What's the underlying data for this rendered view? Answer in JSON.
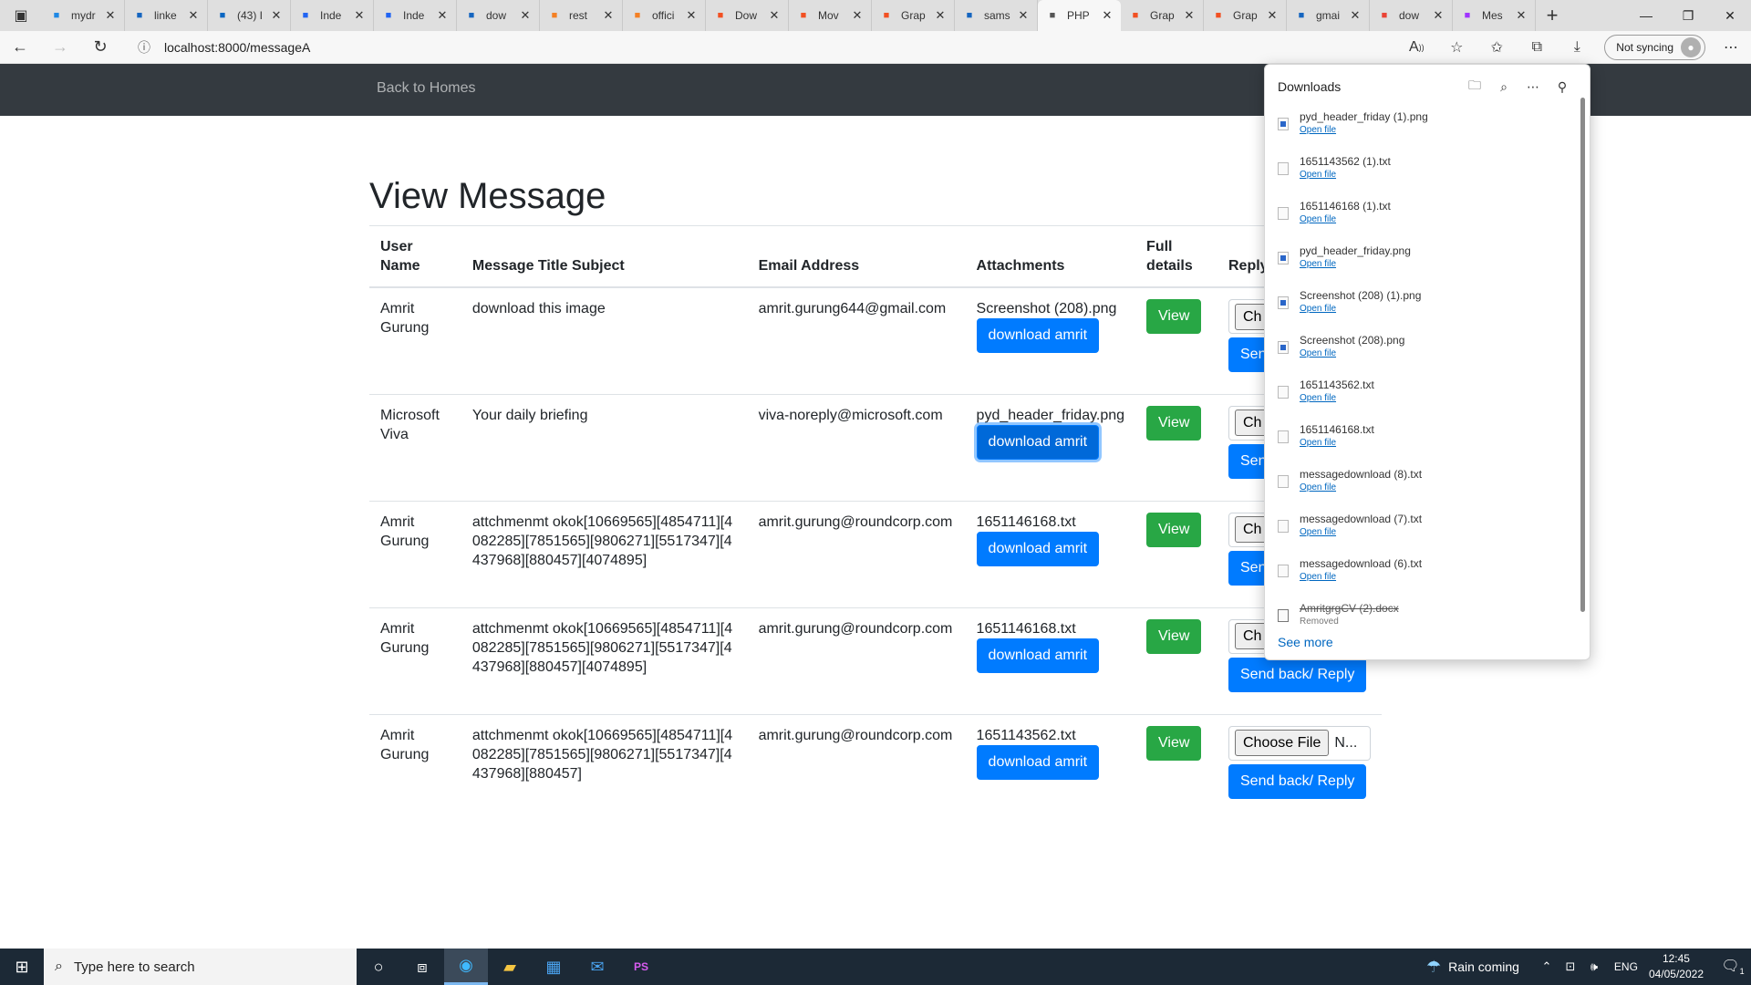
{
  "browser": {
    "tabs": [
      {
        "title": "mydr",
        "favicon": "m-logo-icon",
        "color": "#1e88e5"
      },
      {
        "title": "linke",
        "favicon": "search-icon",
        "color": "#1565c0"
      },
      {
        "title": "(43) I",
        "favicon": "linkedin-icon",
        "color": "#0a66c2"
      },
      {
        "title": "Inde",
        "favicon": "indeed-i-icon",
        "color": "#2164f3"
      },
      {
        "title": "Inde",
        "favicon": "indeed-icon",
        "color": "#2164f3"
      },
      {
        "title": "dow",
        "favicon": "search-icon",
        "color": "#1565c0"
      },
      {
        "title": "rest",
        "favicon": "stackoverflow-icon",
        "color": "#f48024"
      },
      {
        "title": "offici",
        "favicon": "stackoverflow-icon",
        "color": "#f48024"
      },
      {
        "title": "Dow",
        "favicon": "microsoft-icon",
        "color": "#f25022"
      },
      {
        "title": "Mov",
        "favicon": "microsoft-icon",
        "color": "#f25022"
      },
      {
        "title": "Grap",
        "favicon": "microsoft-icon",
        "color": "#f25022"
      },
      {
        "title": "sams",
        "favicon": "search-icon",
        "color": "#1565c0"
      },
      {
        "title": "PHP",
        "favicon": "page-icon",
        "color": "#555555",
        "active": true
      },
      {
        "title": "Grap",
        "favicon": "microsoft-icon",
        "color": "#f25022"
      },
      {
        "title": "Grap",
        "favicon": "microsoft-icon",
        "color": "#f25022"
      },
      {
        "title": "gmai",
        "favicon": "search-icon",
        "color": "#1565c0"
      },
      {
        "title": "dow",
        "favicon": "gmail-icon",
        "color": "#ea4335"
      },
      {
        "title": "Mes",
        "favicon": "messenger-icon",
        "color": "#a033ff"
      }
    ],
    "url": "localhost:8000/messageA",
    "sync_label": "Not syncing"
  },
  "page": {
    "nav_link": "Back to Homes",
    "title": "View Message",
    "columns": {
      "user_name": "User Name",
      "subject": "Message Title Subject",
      "email": "Email Address",
      "attachments": "Attachments",
      "full_details": "Full details",
      "reply": "Reply attac"
    },
    "rows": [
      {
        "user": "Amrit Gurung",
        "subject": "download this image",
        "email": "amrit.gurung644@gmail.com",
        "attachment": "Screenshot (208).png",
        "download_label": "download amrit",
        "view_label": "View",
        "choose_label": "Ch",
        "reply_label": "Send"
      },
      {
        "user": "Microsoft Viva",
        "subject": "Your daily briefing",
        "email": "viva-noreply@microsoft.com",
        "attachment": "pyd_header_friday.png",
        "download_label": "download amrit",
        "view_label": "View",
        "choose_label": "Ch",
        "reply_label": "Send",
        "focused": true
      },
      {
        "user": "Amrit Gurung",
        "subject": "attchmenmt okok[10669565][4854711][4082285][7851565][9806271][5517347][4437968][880457][4074895]",
        "email": "amrit.gurung@roundcorp.com",
        "attachment": "1651146168.txt",
        "download_label": "download amrit",
        "view_label": "View",
        "choose_label": "Ch",
        "reply_label": "Send"
      },
      {
        "user": "Amrit Gurung",
        "subject": "attchmenmt okok[10669565][4854711][4082285][7851565][9806271][5517347][4437968][880457][4074895]",
        "email": "amrit.gurung@roundcorp.com",
        "attachment": "1651146168.txt",
        "download_label": "download amrit",
        "view_label": "View",
        "choose_label": "Ch",
        "reply_label": "Send back/ Reply"
      },
      {
        "user": "Amrit Gurung",
        "subject": "attchmenmt okok[10669565][4854711][4082285][7851565][9806271][5517347][4437968][880457]",
        "email": "amrit.gurung@roundcorp.com",
        "attachment": "1651143562.txt",
        "download_label": "download amrit",
        "view_label": "View",
        "choose_label": "Choose File",
        "no_file_label": "N...",
        "reply_label": "Send back/ Reply"
      }
    ]
  },
  "downloads": {
    "title": "Downloads",
    "items": [
      {
        "name": "pyd_header_friday (1).png",
        "action": "Open file",
        "kind": "img"
      },
      {
        "name": "1651143562 (1).txt",
        "action": "Open file",
        "kind": "txt"
      },
      {
        "name": "1651146168 (1).txt",
        "action": "Open file",
        "kind": "txt"
      },
      {
        "name": "pyd_header_friday.png",
        "action": "Open file",
        "kind": "img"
      },
      {
        "name": "Screenshot (208) (1).png",
        "action": "Open file",
        "kind": "img"
      },
      {
        "name": "Screenshot (208).png",
        "action": "Open file",
        "kind": "img"
      },
      {
        "name": "1651143562.txt",
        "action": "Open file",
        "kind": "txt"
      },
      {
        "name": "1651146168.txt",
        "action": "Open file",
        "kind": "txt"
      },
      {
        "name": "messagedownload (8).txt",
        "action": "Open file",
        "kind": "txt"
      },
      {
        "name": "messagedownload (7).txt",
        "action": "Open file",
        "kind": "txt"
      },
      {
        "name": "messagedownload (6).txt",
        "action": "Open file",
        "kind": "txt"
      },
      {
        "name": "AmritgrgCV (2).docx",
        "action": "Removed",
        "kind": "doc",
        "removed": true
      }
    ],
    "see_more": "See more"
  },
  "taskbar": {
    "search_placeholder": "Type here to search",
    "weather": "Rain coming",
    "lang": "ENG",
    "time": "12:45",
    "date": "04/05/2022",
    "notif_count": "1"
  }
}
